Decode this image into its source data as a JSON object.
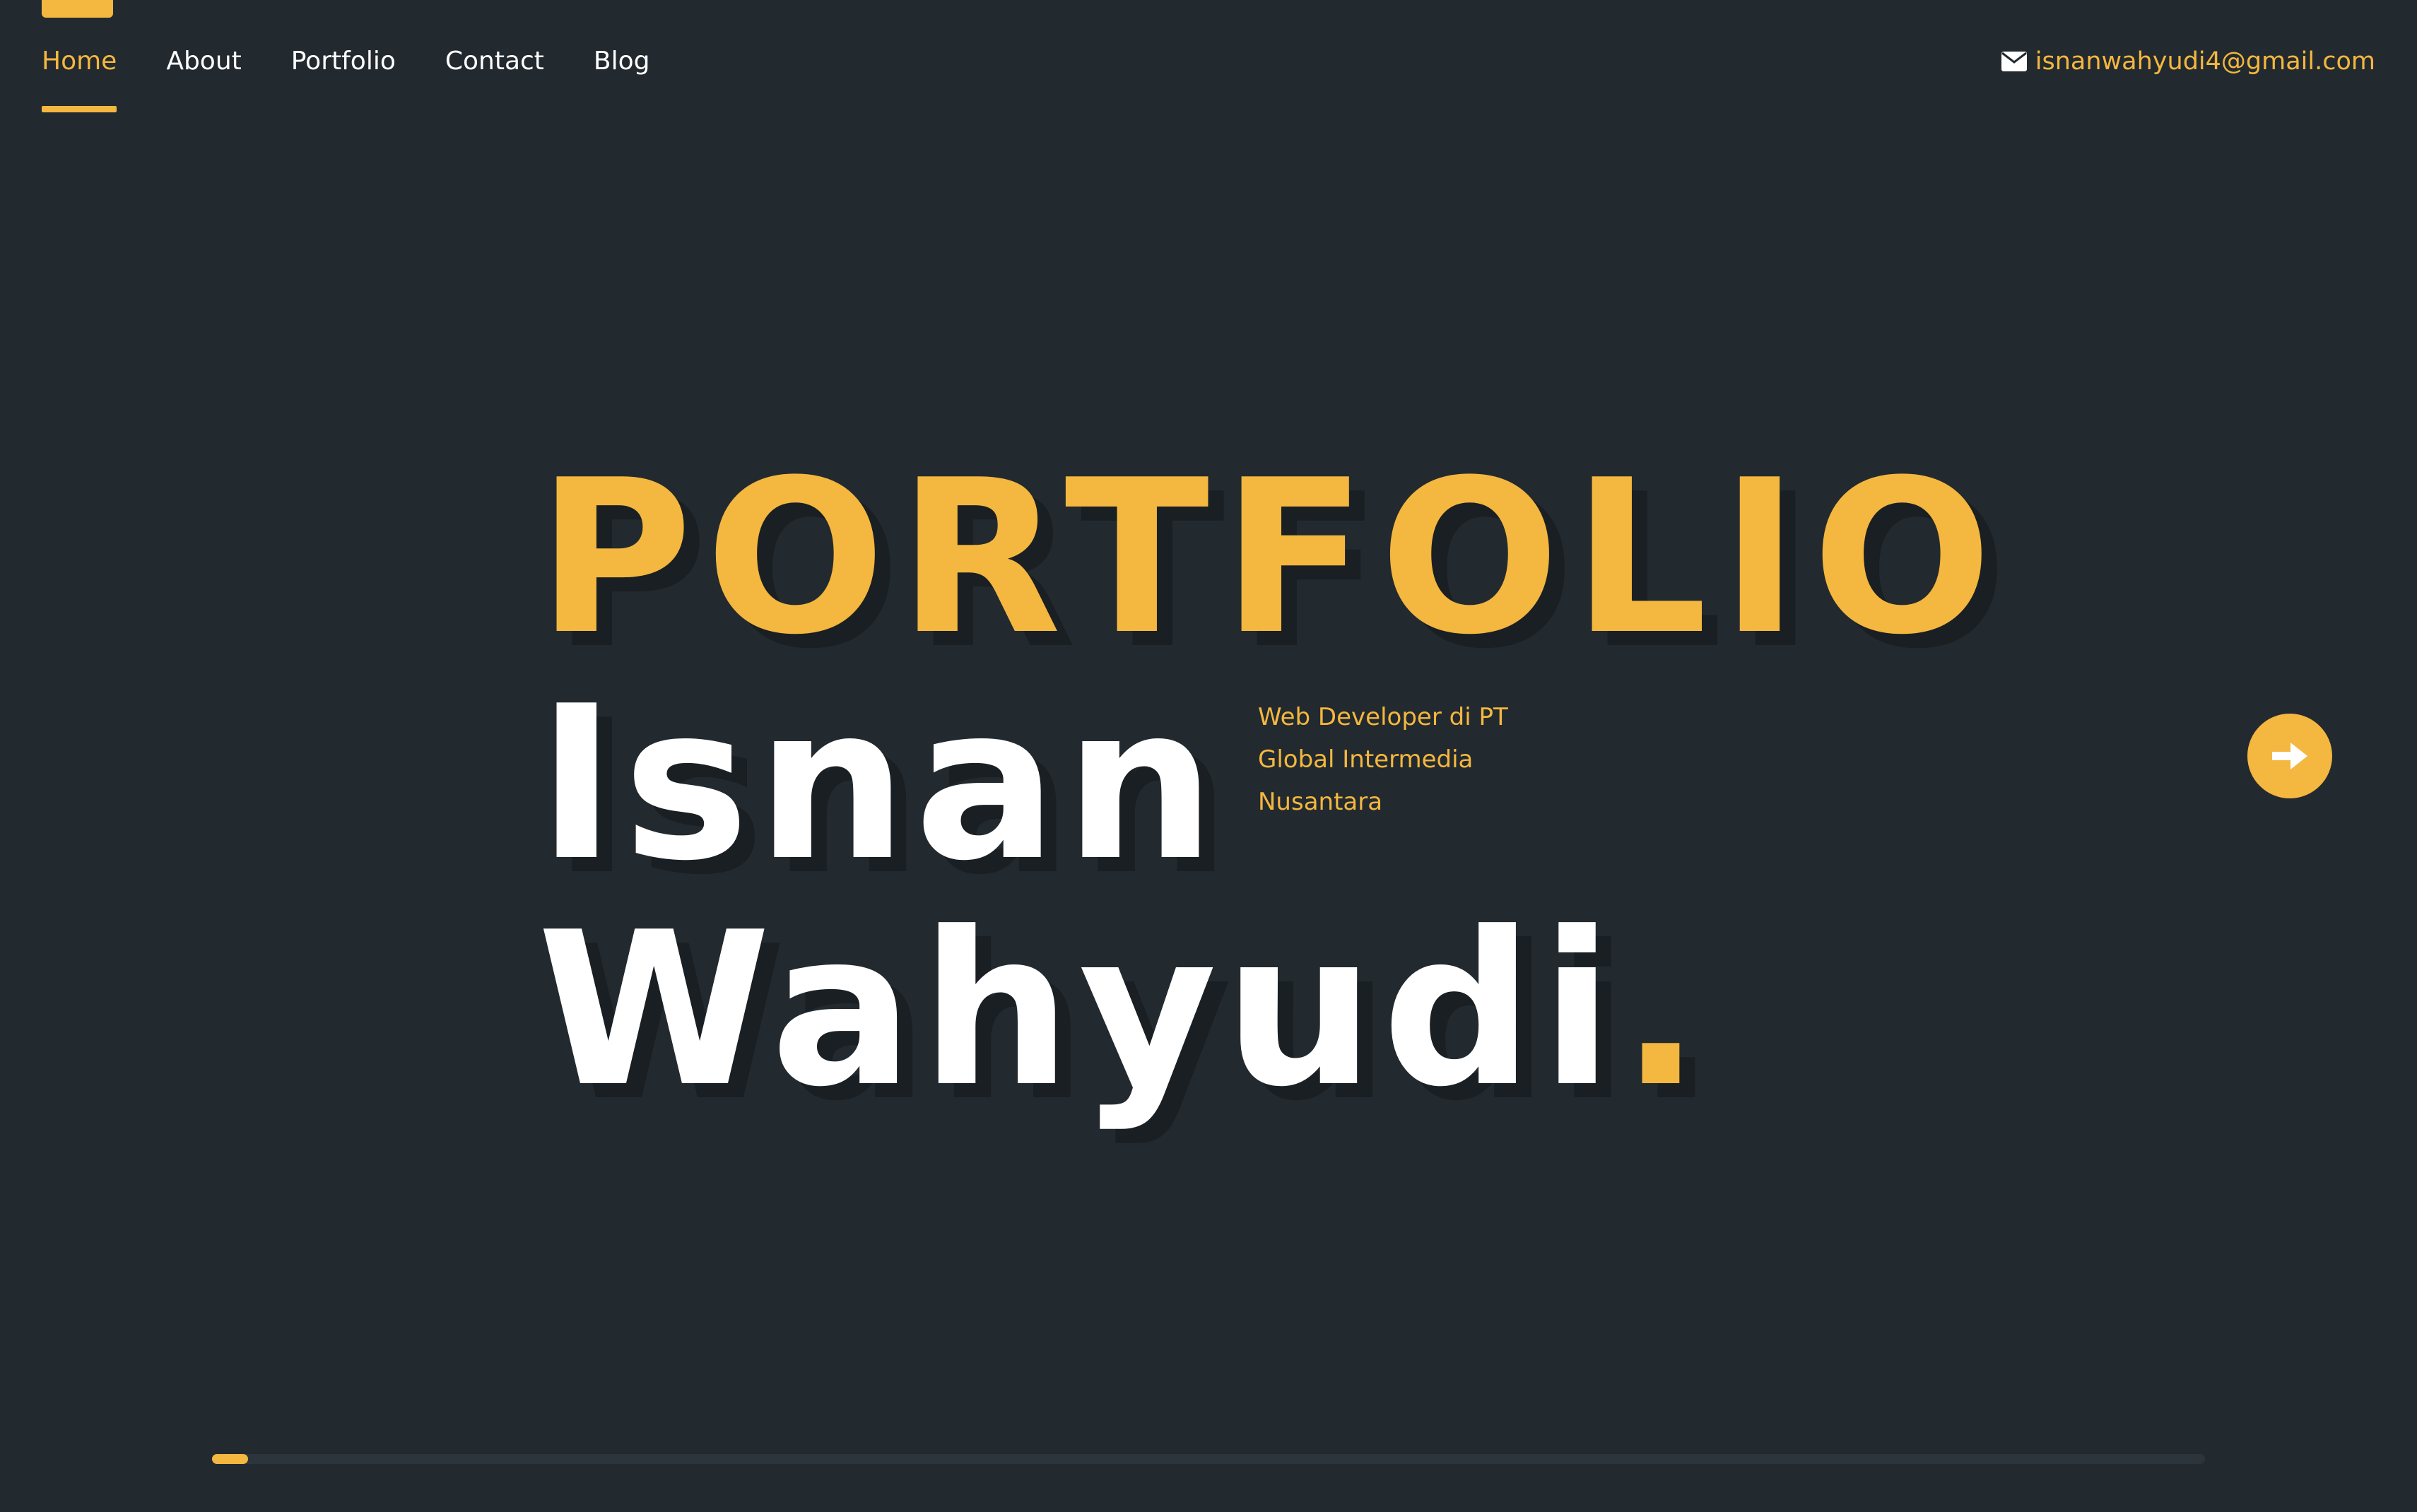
{
  "nav": {
    "items": [
      {
        "label": "Home",
        "active": true
      },
      {
        "label": "About",
        "active": false
      },
      {
        "label": "Portfolio",
        "active": false
      },
      {
        "label": "Contact",
        "active": false
      },
      {
        "label": "Blog",
        "active": false
      }
    ]
  },
  "contact": {
    "email": "isnanwahyudi4@gmail.com",
    "icon": "envelope-icon"
  },
  "hero": {
    "title": "PORTFOLIO",
    "first_name": "Isnan",
    "last_name": "Wahyudi",
    "dot": ".",
    "subtitle_lines": [
      "Web Developer di PT",
      "Global Intermedia",
      "Nusantara"
    ]
  },
  "next": {
    "icon": "arrow-right-icon"
  },
  "progress": {
    "value": 0.018
  },
  "colors": {
    "background": "#232a2f",
    "accent": "#f4b73f",
    "text": "#ffffff",
    "shadow": "#1a1f23"
  }
}
